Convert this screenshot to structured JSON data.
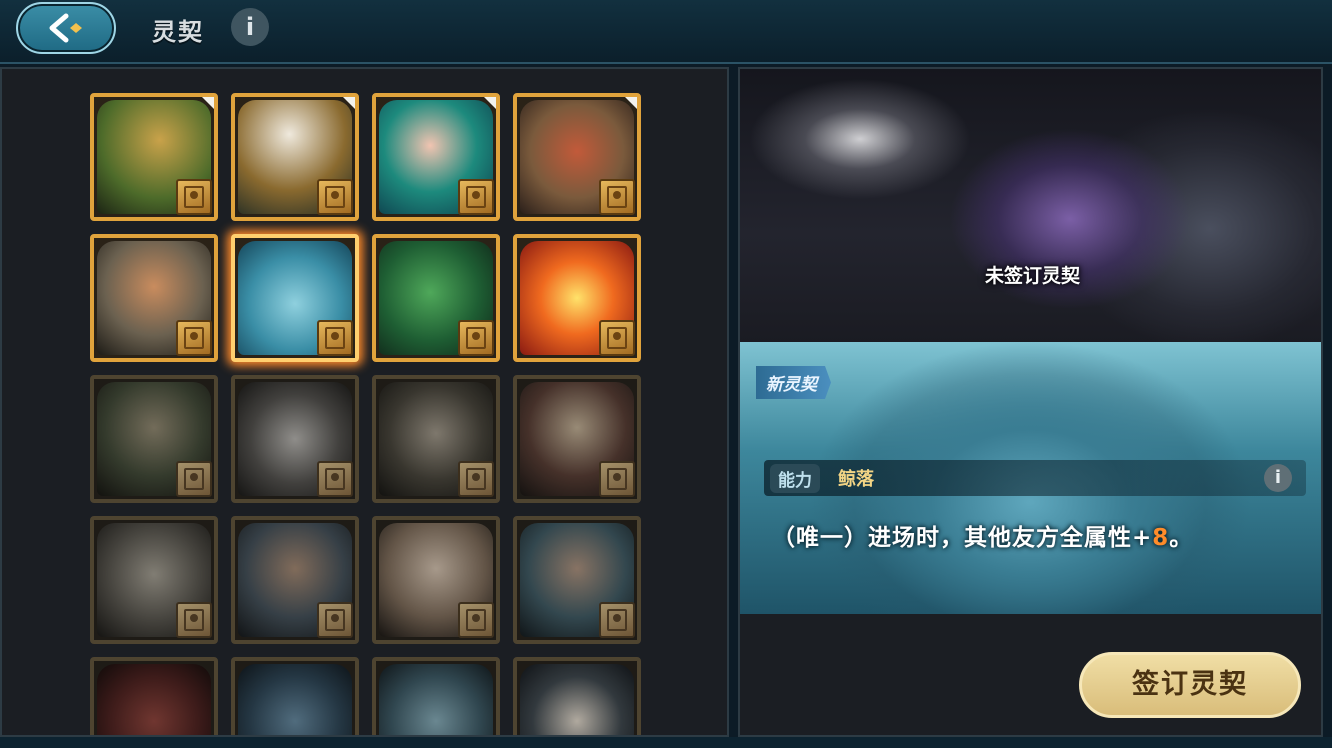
{
  "header": {
    "title": "灵契",
    "info_icon": "i",
    "back_icon": "back-arrow-icon"
  },
  "colors": {
    "accent_gold": "#e0a33c",
    "selected_glow": "#ff8a2a",
    "highlight_number": "#ff8c2a",
    "button_cream": "#f0dea5"
  },
  "cards": [
    {
      "name": "armored-warrior",
      "state": "unlocked",
      "new_flag": true
    },
    {
      "name": "eagle-warrior",
      "state": "unlocked",
      "new_flag": true
    },
    {
      "name": "siren",
      "state": "unlocked",
      "new_flag": true
    },
    {
      "name": "horned-dwarf",
      "state": "unlocked",
      "new_flag": true
    },
    {
      "name": "swordsman",
      "state": "unlocked",
      "new_flag": false
    },
    {
      "name": "great-wave",
      "state": "selected",
      "new_flag": false
    },
    {
      "name": "green-dragon",
      "state": "unlocked",
      "new_flag": false
    },
    {
      "name": "phoenix",
      "state": "unlocked",
      "new_flag": false
    },
    {
      "name": "archer",
      "state": "locked",
      "new_flag": false
    },
    {
      "name": "wolf",
      "state": "locked",
      "new_flag": false
    },
    {
      "name": "old-man",
      "state": "locked",
      "new_flag": false
    },
    {
      "name": "shield-warrior",
      "state": "locked",
      "new_flag": false
    },
    {
      "name": "elephant-knight",
      "state": "locked",
      "new_flag": false
    },
    {
      "name": "bearded-man",
      "state": "locked",
      "new_flag": false
    },
    {
      "name": "winged-woman",
      "state": "locked",
      "new_flag": false
    },
    {
      "name": "sailor",
      "state": "locked",
      "new_flag": false
    },
    {
      "name": "red-beast",
      "state": "locked",
      "new_flag": false
    },
    {
      "name": "blue-dragon",
      "state": "locked",
      "new_flag": false
    },
    {
      "name": "sea-spirit",
      "state": "locked",
      "new_flag": false
    },
    {
      "name": "puffin",
      "state": "locked",
      "new_flag": false
    }
  ],
  "detail": {
    "status_label": "未签订灵契",
    "new_badge": "新灵契",
    "ability_tag": "能力",
    "ability_name": "鲸落",
    "ability_info": "i",
    "desc_before": "（唯一）进场时，其他友方全属性+",
    "desc_number": "8",
    "desc_after": "。"
  },
  "actions": {
    "sign_button": "签订灵契"
  }
}
